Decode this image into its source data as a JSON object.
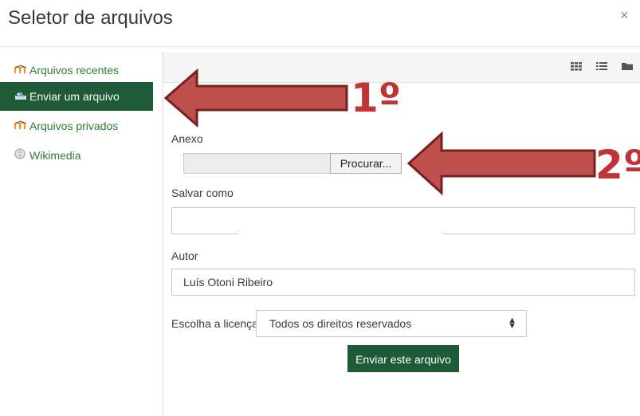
{
  "dialog": {
    "title": "Seletor de arquivos",
    "close_label": "×"
  },
  "sidebar": {
    "items": [
      {
        "label": "Arquivos recentes",
        "icon": "moodle-icon",
        "active": false
      },
      {
        "label": "Enviar um arquivo",
        "icon": "upload-icon",
        "active": true
      },
      {
        "label": "Arquivos privados",
        "icon": "moodle-icon",
        "active": false
      },
      {
        "label": "Wikimedia",
        "icon": "wikimedia-icon",
        "active": false
      }
    ]
  },
  "toolbar": {
    "view_buttons": [
      "grid-view-icon",
      "list-view-icon",
      "folder-view-icon"
    ]
  },
  "form": {
    "attachment_label": "Anexo",
    "browse_label": "Procurar...",
    "save_as_label": "Salvar como",
    "save_as_value": "",
    "author_label": "Autor",
    "author_value": "Luís Otoni Ribeiro",
    "license_label": "Escolha a licença",
    "license_value": "Todos os direitos reservados",
    "submit_label": "Enviar este arquivo"
  },
  "annotations": {
    "step1": "1º",
    "step2": "2º",
    "arrow_color": "#c0504d"
  },
  "colors": {
    "accent": "#1d5b36",
    "link": "#2e7d32"
  }
}
